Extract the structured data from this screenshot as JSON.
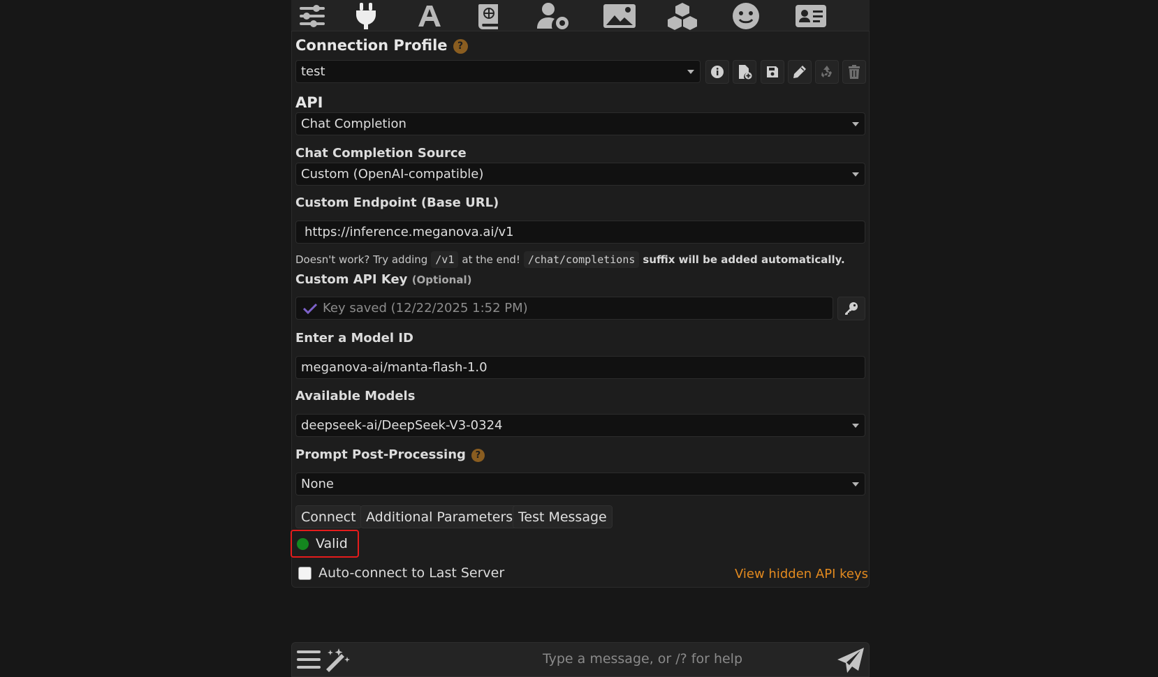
{
  "topbar": {
    "icons": [
      "sliders-icon",
      "plug-icon",
      "font-icon",
      "book-atlas-icon",
      "user-gear-icon",
      "image-icon",
      "cubes-icon",
      "smiley-icon",
      "address-card-icon"
    ]
  },
  "profile": {
    "heading": "Connection Profile",
    "help": "?",
    "selected": "test",
    "buttons": [
      "info-icon",
      "file-add-icon",
      "floppy-icon",
      "pencil-icon",
      "recycle-icon",
      "trash-icon"
    ]
  },
  "api": {
    "heading": "API",
    "selected": "Chat Completion"
  },
  "source": {
    "heading": "Chat Completion Source",
    "selected": "Custom (OpenAI-compatible)"
  },
  "endpoint": {
    "heading": "Custom Endpoint (Base URL)",
    "value": "https://inference.meganova.ai/v1",
    "hint_1": "Doesn't work? Try adding",
    "hint_code_1": "/v1",
    "hint_2": "at the end!",
    "hint_code_2": "/chat/completions",
    "hint_3": "suffix will be added automatically."
  },
  "api_key": {
    "heading": "Custom API Key",
    "optional": "(Optional)",
    "placeholder": "Key saved (12/22/2025 1:52 PM)"
  },
  "model_id": {
    "heading": "Enter a Model ID",
    "value": "meganova-ai/manta-flash-1.0"
  },
  "models": {
    "heading": "Available Models",
    "selected": "deepseek-ai/DeepSeek-V3-0324"
  },
  "post_processing": {
    "heading": "Prompt Post-Processing",
    "help": "?",
    "selected": "None"
  },
  "actions": {
    "connect": "Connect",
    "additional": "Additional Parameters",
    "test": "Test Message"
  },
  "status": {
    "label": "Valid",
    "color": "#14861f"
  },
  "autoconnect": {
    "label": "Auto-connect to Last Server",
    "checked": false
  },
  "hidden_keys_link": "View hidden API keys",
  "chat": {
    "placeholder": "Type a message, or /? for help"
  },
  "colors": {
    "accent": "#e38a1f",
    "highlight_border": "#e51c1c",
    "help_badge": "#8a5d20"
  }
}
